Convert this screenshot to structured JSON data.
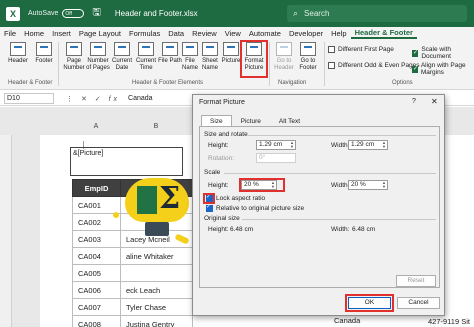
{
  "titlebar": {
    "autosave_label": "AutoSave",
    "autosave_state": "Off",
    "title": "Header and Footer.xlsx",
    "search_placeholder": "Search"
  },
  "menu": [
    "File",
    "Home",
    "Insert",
    "Page Layout",
    "Formulas",
    "Data",
    "Review",
    "View",
    "Automate",
    "Developer",
    "Help",
    "Header & Footer"
  ],
  "ribbon": {
    "buttons": [
      {
        "label": "Header",
        "icon": "header-icon"
      },
      {
        "label": "Footer",
        "icon": "footer-icon"
      },
      {
        "label": "Page Number",
        "icon": "page-number-icon"
      },
      {
        "label": "Number of Pages",
        "icon": "number-of-pages-icon"
      },
      {
        "label": "Current Date",
        "icon": "current-date-icon"
      },
      {
        "label": "Current Time",
        "icon": "current-time-icon"
      },
      {
        "label": "File Path",
        "icon": "file-path-icon"
      },
      {
        "label": "File Name",
        "icon": "file-name-icon"
      },
      {
        "label": "Sheet Name",
        "icon": "sheet-name-icon"
      },
      {
        "label": "Picture",
        "icon": "picture-icon"
      },
      {
        "label": "Format Picture",
        "icon": "format-picture-icon"
      },
      {
        "label": "Go to Header",
        "icon": "go-to-header-icon"
      },
      {
        "label": "Go to Footer",
        "icon": "go-to-footer-icon"
      }
    ],
    "groups": {
      "header_footer": "Header & Footer",
      "elements": "Header & Footer Elements",
      "navigation": "Navigation",
      "options": "Options"
    },
    "options": [
      {
        "label": "Different First Page",
        "checked": false
      },
      {
        "label": "Different Odd & Even Pages",
        "checked": false
      },
      {
        "label": "Scale with Document",
        "checked": true
      },
      {
        "label": "Align with Page Margins",
        "checked": true
      }
    ]
  },
  "formula_bar": {
    "name_box": "D10",
    "fx": "fx",
    "value": "Canada"
  },
  "sheet": {
    "columns": [
      "A",
      "B",
      "C"
    ],
    "header_text": "&[Picture]",
    "table_headers": [
      "EmpID",
      "Name"
    ],
    "rows": [
      [
        "CA001",
        ""
      ],
      [
        "CA002",
        ""
      ],
      [
        "CA003",
        "Lacey Mcneil"
      ],
      [
        "CA004",
        "aline Whitaker"
      ],
      [
        "CA005",
        ""
      ],
      [
        "CA006",
        "eck Leach"
      ],
      [
        "CA007",
        "Tyler Chase"
      ],
      [
        "CA008",
        "Justina Gentry"
      ]
    ],
    "extra_address": "427-9119 Sit St.",
    "extra_country": "Canada"
  },
  "dialog": {
    "title": "Format Picture",
    "help": "?",
    "close": "✕",
    "tabs": [
      "Size",
      "Picture",
      "Alt Text"
    ],
    "size_rotate_label": "Size and rotate",
    "height_label": "Height:",
    "height_value": "1.29 cm",
    "width_label": "Width:",
    "width_value": "1.29 cm",
    "rotation_label": "Rotation:",
    "rotation_value": "0°",
    "scale_label": "Scale",
    "scale_height_label": "Height:",
    "scale_height_value": "20 %",
    "scale_width_label": "Width:",
    "scale_width_value": "20 %",
    "lock_aspect": "Lock aspect ratio",
    "relative_original": "Relative to original picture size",
    "original_size_label": "Original size",
    "orig_height_label": "Height:",
    "orig_height_value": "6.48 cm",
    "orig_width_label": "Width:",
    "orig_width_value": "6.48 cm",
    "reset": "Reset",
    "ok": "OK",
    "cancel": "Cancel"
  },
  "colors": {
    "excel_green": "#1e6b41",
    "highlight_red": "#e0312e",
    "table_header": "#404040"
  }
}
